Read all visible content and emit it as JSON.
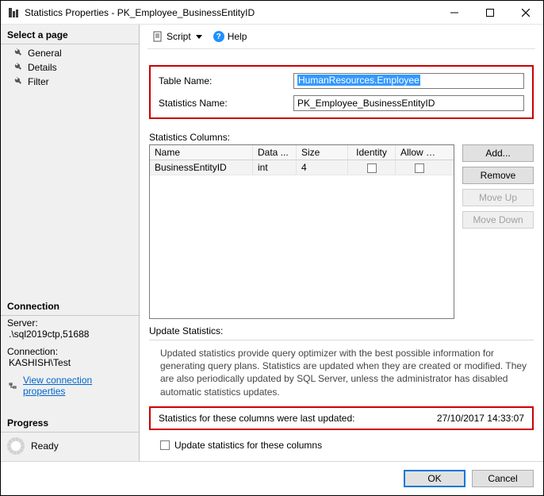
{
  "window": {
    "title": "Statistics Properties - PK_Employee_BusinessEntityID"
  },
  "sidebar": {
    "select_page": "Select a page",
    "pages": [
      {
        "label": "General"
      },
      {
        "label": "Details"
      },
      {
        "label": "Filter"
      }
    ],
    "connection_title": "Connection",
    "server_label": "Server:",
    "server_value": ".\\sql2019ctp,51688",
    "connection_label": "Connection:",
    "connection_value": "KASHISH\\Test",
    "view_conn_props": "View connection properties",
    "progress_title": "Progress",
    "progress_value": "Ready"
  },
  "toolbar": {
    "script": "Script",
    "help": "Help"
  },
  "form": {
    "table_name_label": "Table Name:",
    "table_name_value": "HumanResources.Employee",
    "stats_name_label": "Statistics Name:",
    "stats_name_value": "PK_Employee_BusinessEntityID"
  },
  "columns": {
    "label": "Statistics Columns:",
    "headers": {
      "name": "Name",
      "data_type": "Data ...",
      "size": "Size",
      "identity": "Identity",
      "allow_nulls": "Allow N..."
    },
    "rows": [
      {
        "name": "BusinessEntityID",
        "data_type": "int",
        "size": "4",
        "identity": false,
        "allow_nulls": false
      }
    ],
    "buttons": {
      "add": "Add...",
      "remove": "Remove",
      "move_up": "Move Up",
      "move_down": "Move Down"
    }
  },
  "update": {
    "label": "Update Statistics:",
    "description": "Updated statistics provide query optimizer with the best possible information for generating query plans. Statistics are updated when they are created or modified. They are also periodically updated by SQL Server, unless the administrator has disabled automatic statistics updates.",
    "last_updated_label": "Statistics for these columns were last updated:",
    "last_updated_value": "27/10/2017 14:33:07",
    "checkbox_label": "Update statistics for these columns"
  },
  "footer": {
    "ok": "OK",
    "cancel": "Cancel"
  }
}
